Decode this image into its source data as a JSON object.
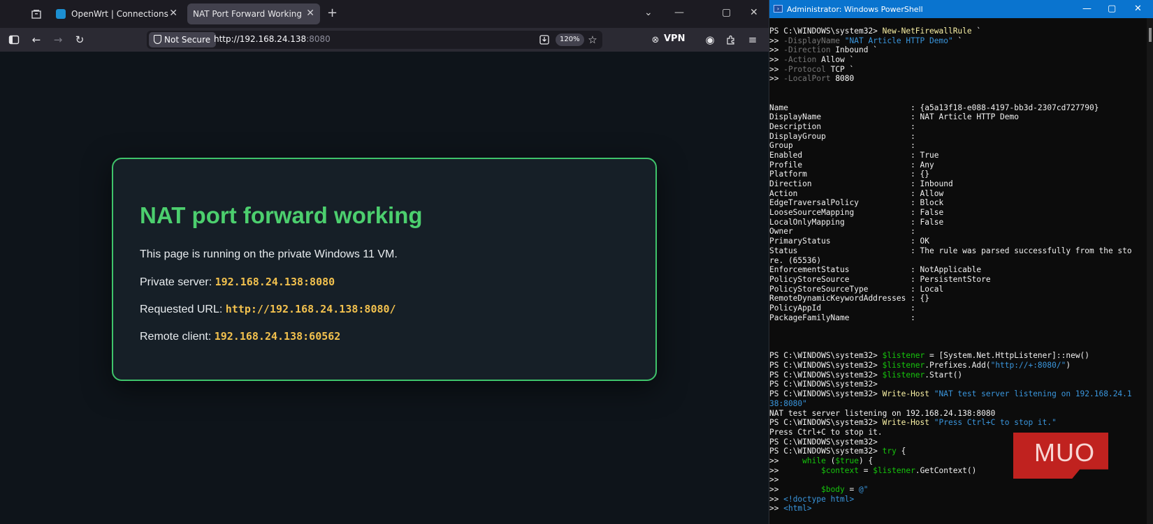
{
  "browser": {
    "tabs": [
      {
        "title": "OpenWrt | Connections"
      },
      {
        "title": "NAT Port Forward Working"
      }
    ],
    "security_label": "Not Secure",
    "url_host": "http://192.168.24.138",
    "url_port": ":8080",
    "zoom": "120%",
    "vpn_label": "VPN"
  },
  "page": {
    "heading": "NAT port forward working",
    "intro": "This page is running on the private Windows 11 VM.",
    "private_server_label": "Private server:",
    "private_server": "192.168.24.138:8080",
    "requested_url_label": "Requested URL:",
    "requested_url": "http://192.168.24.138:8080/",
    "remote_client_label": "Remote client:",
    "remote_client": "192.168.24.138:60562"
  },
  "powershell": {
    "title": "Administrator: Windows PowerShell",
    "lines": [
      [
        {
          "c": "w",
          "t": "PS C:\\WINDOWS\\system32> "
        },
        {
          "c": "y",
          "t": "New-NetFirewallRule"
        },
        {
          "c": "w",
          "t": " `"
        }
      ],
      [
        {
          "c": "w",
          "t": ">> "
        },
        {
          "c": "g",
          "t": "-DisplayName "
        },
        {
          "c": "s",
          "t": "\"NAT Article HTTP Demo\""
        },
        {
          "c": "w",
          "t": " `"
        }
      ],
      [
        {
          "c": "w",
          "t": ">> "
        },
        {
          "c": "g",
          "t": "-Direction "
        },
        {
          "c": "w",
          "t": "Inbound `"
        }
      ],
      [
        {
          "c": "w",
          "t": ">> "
        },
        {
          "c": "g",
          "t": "-Action "
        },
        {
          "c": "w",
          "t": "Allow `"
        }
      ],
      [
        {
          "c": "w",
          "t": ">> "
        },
        {
          "c": "g",
          "t": "-Protocol "
        },
        {
          "c": "w",
          "t": "TCP `"
        }
      ],
      [
        {
          "c": "w",
          "t": ">> "
        },
        {
          "c": "g",
          "t": "-LocalPort "
        },
        {
          "c": "b",
          "t": "8080"
        }
      ],
      [],
      [],
      [
        {
          "c": "w",
          "t": "Name                          : {a5a13f18-e088-4197-bb3d-2307cd727790}"
        }
      ],
      [
        {
          "c": "w",
          "t": "DisplayName                   : NAT Article HTTP Demo"
        }
      ],
      [
        {
          "c": "w",
          "t": "Description                   :"
        }
      ],
      [
        {
          "c": "w",
          "t": "DisplayGroup                  :"
        }
      ],
      [
        {
          "c": "w",
          "t": "Group                         :"
        }
      ],
      [
        {
          "c": "w",
          "t": "Enabled                       : True"
        }
      ],
      [
        {
          "c": "w",
          "t": "Profile                       : Any"
        }
      ],
      [
        {
          "c": "w",
          "t": "Platform                      : {}"
        }
      ],
      [
        {
          "c": "w",
          "t": "Direction                     : Inbound"
        }
      ],
      [
        {
          "c": "w",
          "t": "Action                        : Allow"
        }
      ],
      [
        {
          "c": "w",
          "t": "EdgeTraversalPolicy           : Block"
        }
      ],
      [
        {
          "c": "w",
          "t": "LooseSourceMapping            : False"
        }
      ],
      [
        {
          "c": "w",
          "t": "LocalOnlyMapping              : False"
        }
      ],
      [
        {
          "c": "w",
          "t": "Owner                         :"
        }
      ],
      [
        {
          "c": "w",
          "t": "PrimaryStatus                 : OK"
        }
      ],
      [
        {
          "c": "w",
          "t": "Status                        : The rule was parsed successfully from the sto"
        }
      ],
      [
        {
          "c": "w",
          "t": "re. (65536)"
        }
      ],
      [
        {
          "c": "w",
          "t": "EnforcementStatus             : NotApplicable"
        }
      ],
      [
        {
          "c": "w",
          "t": "PolicyStoreSource             : PersistentStore"
        }
      ],
      [
        {
          "c": "w",
          "t": "PolicyStoreSourceType         : Local"
        }
      ],
      [
        {
          "c": "w",
          "t": "RemoteDynamicKeywordAddresses : {}"
        }
      ],
      [
        {
          "c": "w",
          "t": "PolicyAppId                   :"
        }
      ],
      [
        {
          "c": "w",
          "t": "PackageFamilyName             :"
        }
      ],
      [],
      [],
      [],
      [
        {
          "c": "w",
          "t": "PS C:\\WINDOWS\\system32> "
        },
        {
          "c": "v",
          "t": "$listener"
        },
        {
          "c": "w",
          "t": " = [System.Net.HttpListener]::new()"
        }
      ],
      [
        {
          "c": "w",
          "t": "PS C:\\WINDOWS\\system32> "
        },
        {
          "c": "v",
          "t": "$listener"
        },
        {
          "c": "w",
          "t": ".Prefixes.Add("
        },
        {
          "c": "s",
          "t": "\"http://+:8080/\""
        },
        {
          "c": "w",
          "t": ")"
        }
      ],
      [
        {
          "c": "w",
          "t": "PS C:\\WINDOWS\\system32> "
        },
        {
          "c": "v",
          "t": "$listener"
        },
        {
          "c": "w",
          "t": ".Start()"
        }
      ],
      [
        {
          "c": "w",
          "t": "PS C:\\WINDOWS\\system32>"
        }
      ],
      [
        {
          "c": "w",
          "t": "PS C:\\WINDOWS\\system32> "
        },
        {
          "c": "y",
          "t": "Write-Host"
        },
        {
          "c": "s",
          "t": " \"NAT test server listening on 192.168.24.1"
        }
      ],
      [
        {
          "c": "s",
          "t": "38:8080\""
        }
      ],
      [
        {
          "c": "w",
          "t": "NAT test server listening on 192.168.24.138:8080"
        }
      ],
      [
        {
          "c": "w",
          "t": "PS C:\\WINDOWS\\system32> "
        },
        {
          "c": "y",
          "t": "Write-Host"
        },
        {
          "c": "s",
          "t": " \"Press Ctrl+C to stop it.\""
        }
      ],
      [
        {
          "c": "w",
          "t": "Press Ctrl+C to stop it."
        }
      ],
      [
        {
          "c": "w",
          "t": "PS C:\\WINDOWS\\system32>"
        }
      ],
      [
        {
          "c": "w",
          "t": "PS C:\\WINDOWS\\system32> "
        },
        {
          "c": "v",
          "t": "try"
        },
        {
          "c": "w",
          "t": " {"
        }
      ],
      [
        {
          "c": "w",
          "t": ">>     "
        },
        {
          "c": "v",
          "t": "while"
        },
        {
          "c": "w",
          "t": " ("
        },
        {
          "c": "v",
          "t": "$true"
        },
        {
          "c": "w",
          "t": ") {"
        }
      ],
      [
        {
          "c": "w",
          "t": ">>         "
        },
        {
          "c": "v",
          "t": "$context"
        },
        {
          "c": "w",
          "t": " = "
        },
        {
          "c": "v",
          "t": "$listener"
        },
        {
          "c": "w",
          "t": ".GetContext()"
        }
      ],
      [
        {
          "c": "w",
          "t": ">>"
        }
      ],
      [
        {
          "c": "w",
          "t": ">>         "
        },
        {
          "c": "v",
          "t": "$body"
        },
        {
          "c": "w",
          "t": " = "
        },
        {
          "c": "s",
          "t": "@\""
        }
      ],
      [
        {
          "c": "w",
          "t": ">> "
        },
        {
          "c": "s",
          "t": "<!doctype html>"
        }
      ],
      [
        {
          "c": "w",
          "t": ">> "
        },
        {
          "c": "s",
          "t": "<html>"
        }
      ]
    ]
  },
  "watermark": "MUO"
}
